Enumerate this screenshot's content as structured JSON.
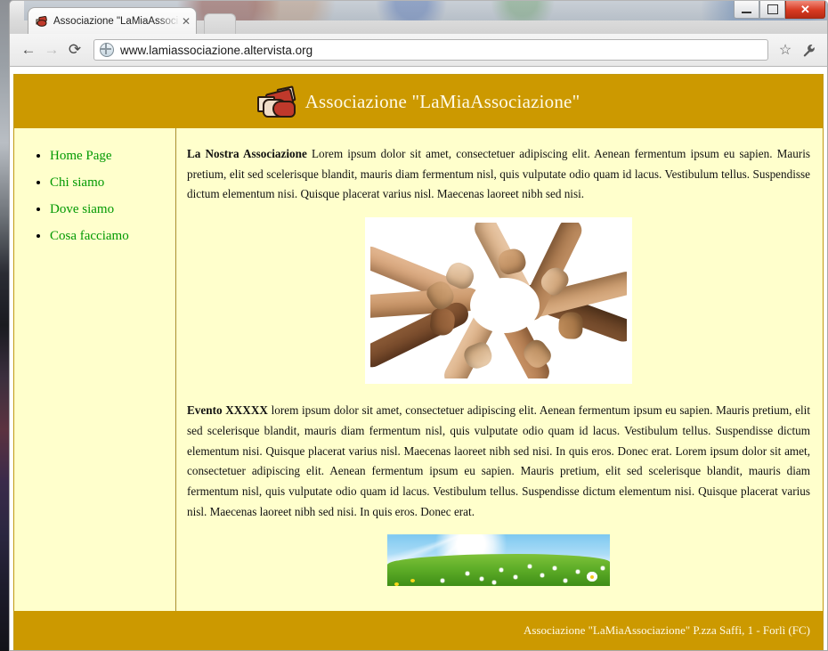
{
  "browser": {
    "tab": {
      "title": "Associazione \"LaMiaAssoci",
      "close_label": "✕",
      "favicon": "handshake-favicon"
    },
    "newtab_label": "",
    "window_controls": {
      "minimize": "minimize-icon",
      "maximize": "maximize-icon",
      "close": "✕"
    },
    "toolbar": {
      "back": "←",
      "forward": "→",
      "reload": "⟳",
      "bookmark": "☆",
      "menu": "wrench-icon",
      "url": "www.lamiassociazione.altervista.org",
      "site_icon": "globe-icon"
    }
  },
  "page": {
    "header": {
      "logo": "handshake-icon",
      "title": "Associazione \"LaMiaAssociazione\""
    },
    "sidebar": {
      "items": [
        {
          "label": "Home Page"
        },
        {
          "label": "Chi siamo"
        },
        {
          "label": "Dove siamo"
        },
        {
          "label": "Cosa facciamo"
        }
      ]
    },
    "content": {
      "article_1": {
        "heading": "La Nostra Associazione",
        "body": " Lorem ipsum dolor sit amet, consectetuer adipiscing elit. Aenean fermentum ipsum eu sapien. Mauris pretium, elit sed scelerisque blandit, mauris diam fermentum nisl, quis vulputate odio quam id lacus. Vestibulum tellus. Suspendisse dictum elementum nisi. Quisque placerat varius nisl. Maecenas laoreet nibh sed nisi."
      },
      "image_1_alt": "hands-joined-in-circle-photo",
      "article_2": {
        "heading": "Evento XXXXX",
        "body": " lorem ipsum dolor sit amet, consectetuer adipiscing elit. Aenean fermentum ipsum eu sapien. Mauris pretium, elit sed scelerisque blandit, mauris diam fermentum nisl, quis vulputate odio quam id lacus. Vestibulum tellus. Suspendisse dictum elementum nisi. Quisque placerat varius nisl. Maecenas laoreet nibh sed nisi. In quis eros. Donec erat. Lorem ipsum dolor sit amet, consectetuer adipiscing elit. Aenean fermentum ipsum eu sapien. Mauris pretium, elit sed scelerisque blandit, mauris diam fermentum nisl, quis vulputate odio quam id lacus. Vestibulum tellus. Suspendisse dictum elementum nisi. Quisque placerat varius nisl. Maecenas laoreet nibh sed nisi. In quis eros. Donec erat."
      },
      "image_2_alt": "sunny-meadow-banner-photo"
    },
    "footer": {
      "text": "Associazione \"LaMiaAssociazione\" P.zza Saffi, 1 - Forlì (FC)"
    },
    "colors": {
      "band": "#cc9900",
      "page_bg": "#ffffcc",
      "link": "#009900",
      "border": "#a99030",
      "header_text": "#fffbe8"
    }
  }
}
